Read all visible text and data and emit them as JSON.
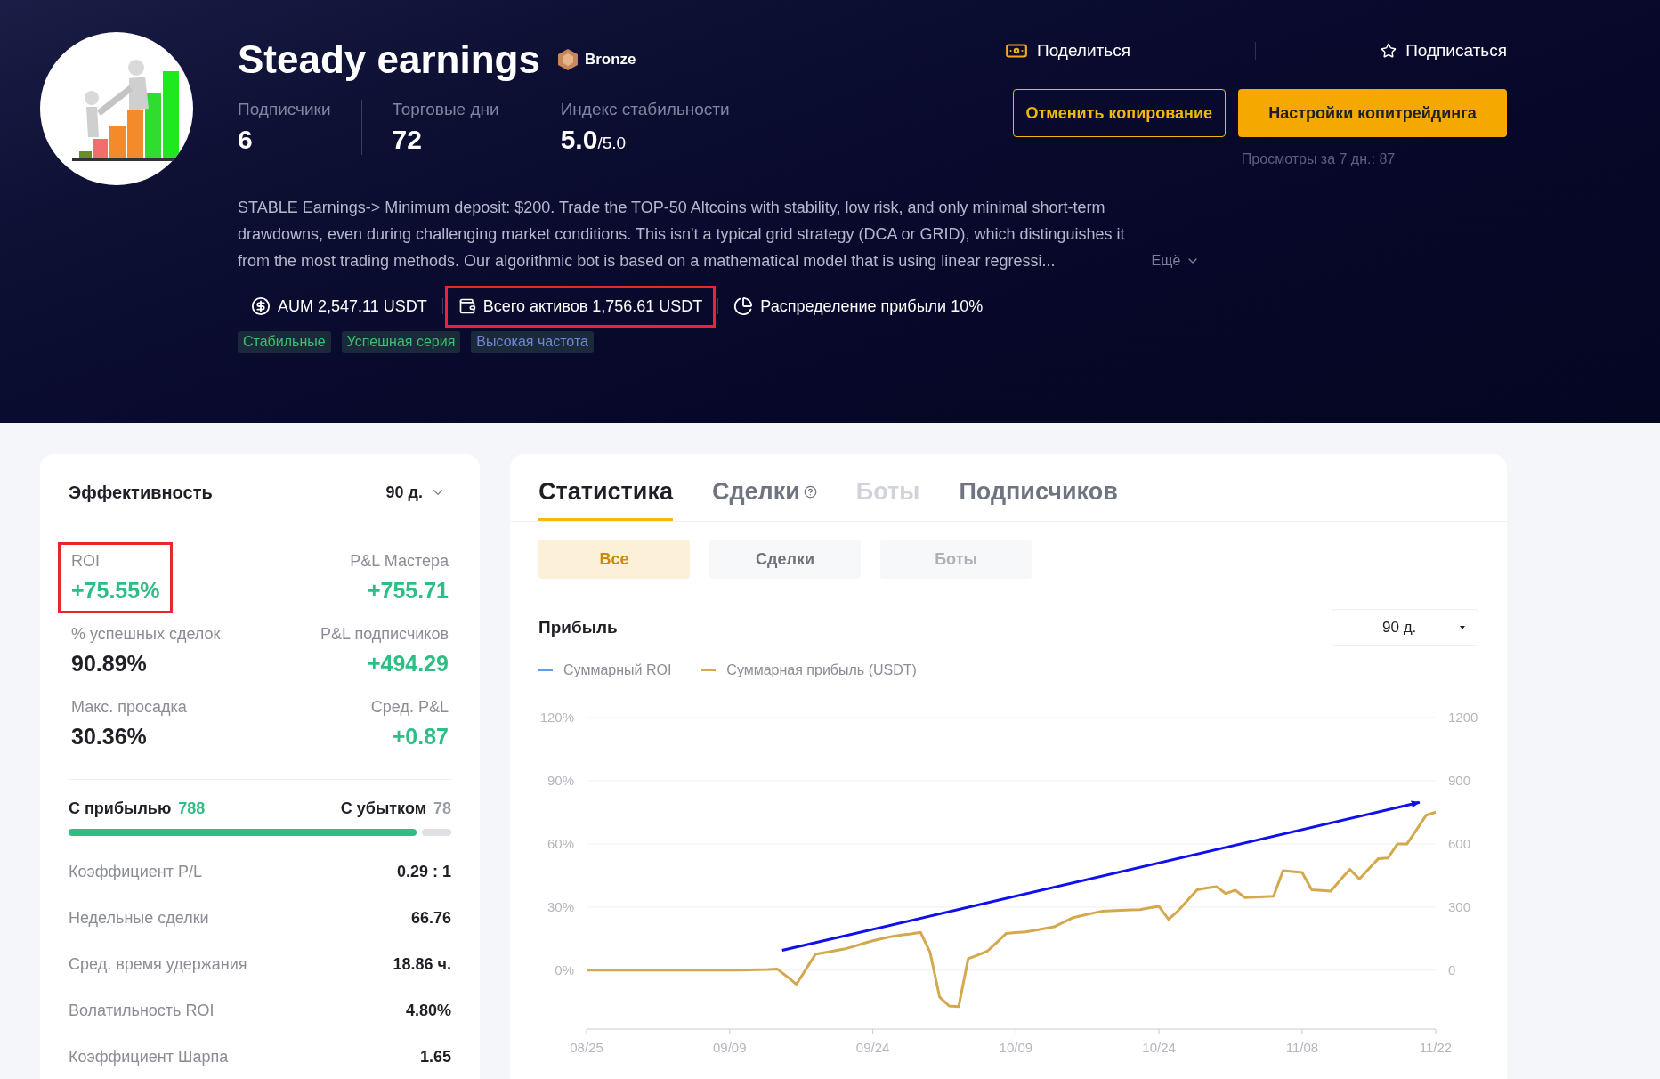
{
  "profile": {
    "name": "Steady earnings",
    "badge": "Bronze",
    "stats": [
      {
        "label": "Подписчики",
        "value": "6"
      },
      {
        "label": "Торговые дни",
        "value": "72"
      },
      {
        "label": "Индекс стабильности",
        "value": "5.0",
        "suffix": "/5.0"
      }
    ],
    "description": [
      "STABLE Earnings-> Minimum deposit: $200. Trade the TOP-50 Altcoins with stability, low risk, and only minimal short-term",
      "drawdowns, even during challenging market conditions. This isn't a typical grid strategy (DCA or GRID), which distinguishes it",
      "from the most trading methods. Our algorithmic bot is based on a mathematical model that is using linear regressi..."
    ],
    "more": "Ещё",
    "meta": [
      {
        "kind": "aum",
        "text": "AUM 2,547.11 USDT",
        "highlighted": false
      },
      {
        "kind": "assets",
        "text": "Всего активов 1,756.61 USDT",
        "highlighted": true
      },
      {
        "kind": "profit_share",
        "text": "Распределение прибыли 10%",
        "highlighted": false
      }
    ],
    "tags": [
      {
        "label": "Стабильные",
        "kind": "success"
      },
      {
        "label": "Успешная серия",
        "kind": "success"
      },
      {
        "label": "Высокая частота",
        "kind": "info"
      }
    ]
  },
  "actions": {
    "share": "Поделиться",
    "subscribe": "Подписаться",
    "cancel": "Отменить копирование",
    "settings": "Настройки копитрейдинга",
    "views": "Просмотры за 7 дн.: 87"
  },
  "performance": {
    "title": "Эффективность",
    "period": "90 д.",
    "stats": [
      {
        "label": "ROI",
        "value": "+75.55%",
        "kind": "gain",
        "highlighted": true
      },
      {
        "label": "P&L Мастера",
        "value": "+755.71",
        "kind": "gain",
        "highlighted": false
      },
      {
        "label": "% успешных сделок",
        "value": "90.89%",
        "kind": "plain",
        "highlighted": false
      },
      {
        "label": "P&L подписчиков",
        "value": "+494.29",
        "kind": "gain",
        "highlighted": false
      },
      {
        "label": "Макс. просадка",
        "value": "30.36%",
        "kind": "plain",
        "highlighted": false
      },
      {
        "label": "Сред. P&L",
        "value": "+0.87",
        "kind": "gain",
        "highlighted": false
      }
    ],
    "wins": {
      "label": "С прибылью",
      "count": "788"
    },
    "losses": {
      "label": "С убытком",
      "count": "78"
    },
    "win_bar": {
      "level": 0.91
    },
    "details": [
      {
        "label": "Коэффициент P/L",
        "value": "0.29 : 1"
      },
      {
        "label": "Недельные сделки",
        "value": "66.76"
      },
      {
        "label": "Сред. время удержания",
        "value": "18.86 ч."
      },
      {
        "label": "Волатильность ROI",
        "value": "4.80%"
      },
      {
        "label": "Коэффициент Шарпа",
        "value": "1.65"
      }
    ]
  },
  "stats_panel": {
    "tabs": [
      {
        "label": "Статистика",
        "selected": true,
        "disabled": false,
        "help": false
      },
      {
        "label": "Сделки",
        "selected": false,
        "disabled": false,
        "help": true
      },
      {
        "label": "Боты",
        "selected": false,
        "disabled": true,
        "help": false
      },
      {
        "label": "Подписчиков",
        "selected": false,
        "disabled": false,
        "help": false
      }
    ],
    "filters": [
      {
        "label": "Все",
        "selected": true,
        "disabled": false
      },
      {
        "label": "Сделки",
        "selected": false,
        "disabled": false
      },
      {
        "label": "Боты",
        "selected": false,
        "disabled": true
      }
    ],
    "profit_title": "Прибыль",
    "period": "90 д.",
    "roi_legend": {
      "label": "Суммарный ROI",
      "color": "#5b9cf2"
    },
    "annotation_arrow": {
      "color": "#1010ee"
    },
    "chart_data": {
      "type": "line",
      "grid": true,
      "categories": [
        "08/25",
        null,
        null,
        null,
        null,
        null,
        null,
        null,
        null,
        null,
        null,
        null,
        null,
        null,
        null,
        "09/09",
        null,
        null,
        null,
        null,
        null,
        null,
        null,
        null,
        null,
        null,
        null,
        null,
        null,
        null,
        "09/24",
        null,
        null,
        null,
        null,
        null,
        null,
        null,
        null,
        null,
        null,
        null,
        null,
        null,
        null,
        "10/09",
        null,
        null,
        null,
        null,
        null,
        null,
        null,
        null,
        null,
        null,
        null,
        null,
        null,
        null,
        "10/24",
        null,
        null,
        null,
        null,
        null,
        null,
        null,
        null,
        null,
        null,
        null,
        null,
        null,
        null,
        "11/08",
        null,
        null,
        null,
        null,
        null,
        null,
        null,
        null,
        null,
        null,
        null,
        null,
        null,
        "11/22"
      ],
      "series": [
        {
          "name": "Суммарная прибыль (USDT)",
          "color": "#d4a94e",
          "values": [
            0,
            0,
            0,
            0,
            0,
            0,
            0,
            0,
            0,
            0,
            0,
            0,
            0,
            0,
            0,
            0,
            0,
            1,
            2,
            3,
            5,
            -30,
            -67,
            5,
            76,
            84,
            92,
            100,
            113,
            127,
            140,
            150,
            160,
            167,
            173,
            180,
            85,
            -127,
            -170,
            -173,
            55,
            72,
            90,
            132,
            175,
            179,
            182,
            190,
            198,
            206,
            228,
            250,
            260,
            270,
            280,
            282,
            284,
            286,
            288,
            296,
            303,
            242,
            282,
            332,
            382,
            390,
            397,
            364,
            380,
            345,
            347,
            349,
            351,
            473,
            468,
            464,
            382,
            379,
            376,
            428,
            479,
            433,
            482,
            530,
            533,
            600,
            600,
            668,
            736,
            751
          ]
        }
      ],
      "ylim": [
        -280,
        1200
      ],
      "y2lim": [
        -28,
        120
      ],
      "yticks": [
        {
          "value": 0,
          "label": "0"
        },
        {
          "value": 300,
          "label": "300"
        },
        {
          "value": 600,
          "label": "600"
        },
        {
          "value": 900,
          "label": "900"
        },
        {
          "value": 1200,
          "label": "1200"
        }
      ],
      "y2ticks": [
        {
          "value": 0,
          "label": "0%"
        },
        {
          "value": 30,
          "label": "30%"
        },
        {
          "value": 60,
          "label": "60%"
        },
        {
          "value": 90,
          "label": "90%"
        },
        {
          "value": 120,
          "label": "120%"
        }
      ]
    }
  }
}
